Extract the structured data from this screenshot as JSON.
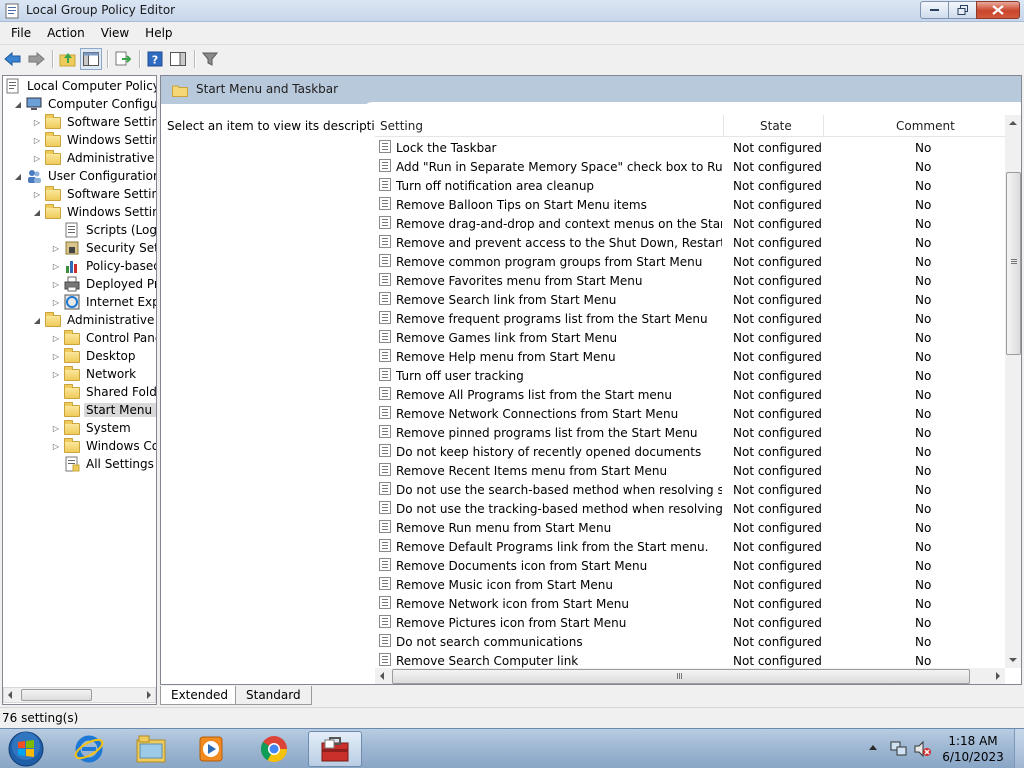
{
  "window": {
    "title": "Local Group Policy Editor",
    "controls": [
      "minimize-icon",
      "restore-icon",
      "close-icon"
    ]
  },
  "menu": [
    "File",
    "Action",
    "View",
    "Help"
  ],
  "toolbar": [
    "back-arrow-icon",
    "forward-arrow-icon",
    "up-folder-icon",
    "show-hide-tree-icon",
    "export-list-icon",
    "help-icon",
    "properties-pane-icon",
    "filter-icon"
  ],
  "tree": {
    "root": "Local Computer Policy",
    "items": [
      {
        "label": "Computer Configura",
        "level": 1,
        "expander": "expanded",
        "icon": "computer-icon"
      },
      {
        "label": "Software Settings",
        "level": 2,
        "expander": "collapsed",
        "icon": "folder-icon"
      },
      {
        "label": "Windows Setting",
        "level": 2,
        "expander": "collapsed",
        "icon": "folder-icon"
      },
      {
        "label": "Administrative Te",
        "level": 2,
        "expander": "collapsed",
        "icon": "folder-icon"
      },
      {
        "label": "User Configuration",
        "level": 1,
        "expander": "expanded",
        "icon": "users-icon"
      },
      {
        "label": "Software Settings",
        "level": 2,
        "expander": "collapsed",
        "icon": "folder-icon"
      },
      {
        "label": "Windows Setting",
        "level": 2,
        "expander": "expanded",
        "icon": "folder-icon"
      },
      {
        "label": "Scripts (Logon",
        "level": 3,
        "expander": "none",
        "icon": "script-icon"
      },
      {
        "label": "Security Settin",
        "level": 3,
        "expander": "collapsed",
        "icon": "security-icon"
      },
      {
        "label": "Policy-based",
        "level": 3,
        "expander": "collapsed",
        "icon": "chart-icon"
      },
      {
        "label": "Deployed Prin",
        "level": 3,
        "expander": "collapsed",
        "icon": "printer-icon"
      },
      {
        "label": "Internet Explo",
        "level": 3,
        "expander": "collapsed",
        "icon": "internet-icon"
      },
      {
        "label": "Administrative Te",
        "level": 2,
        "expander": "expanded",
        "icon": "folder-icon"
      },
      {
        "label": "Control Panel",
        "level": 3,
        "expander": "collapsed",
        "icon": "folder-icon"
      },
      {
        "label": "Desktop",
        "level": 3,
        "expander": "collapsed",
        "icon": "folder-icon"
      },
      {
        "label": "Network",
        "level": 3,
        "expander": "collapsed",
        "icon": "folder-icon"
      },
      {
        "label": "Shared Folder",
        "level": 3,
        "expander": "none",
        "icon": "folder-icon"
      },
      {
        "label": "Start Menu ar",
        "level": 3,
        "expander": "none",
        "icon": "folder-icon",
        "selected": true
      },
      {
        "label": "System",
        "level": 3,
        "expander": "collapsed",
        "icon": "folder-icon"
      },
      {
        "label": "Windows Cor",
        "level": 3,
        "expander": "collapsed",
        "icon": "folder-icon"
      },
      {
        "label": "All Settings",
        "level": 3,
        "expander": "none",
        "icon": "all-settings-icon"
      }
    ]
  },
  "main": {
    "header_title": "Start Menu and Taskbar",
    "description": "Select an item to view its description.",
    "columns": {
      "setting": "Setting",
      "state": "State",
      "comment": "Comment"
    },
    "rows": [
      {
        "setting": "Lock the Taskbar",
        "state": "Not configured",
        "comment": "No"
      },
      {
        "setting": "Add \"Run in Separate Memory Space\" check box to Run dial...",
        "state": "Not configured",
        "comment": "No"
      },
      {
        "setting": "Turn off notification area cleanup",
        "state": "Not configured",
        "comment": "No"
      },
      {
        "setting": "Remove Balloon Tips on Start Menu items",
        "state": "Not configured",
        "comment": "No"
      },
      {
        "setting": "Remove drag-and-drop and context menus on the Start Me...",
        "state": "Not configured",
        "comment": "No"
      },
      {
        "setting": "Remove and prevent access to the Shut Down, Restart, Sleep...",
        "state": "Not configured",
        "comment": "No"
      },
      {
        "setting": "Remove common program groups from Start Menu",
        "state": "Not configured",
        "comment": "No"
      },
      {
        "setting": "Remove Favorites menu from Start Menu",
        "state": "Not configured",
        "comment": "No"
      },
      {
        "setting": "Remove Search link from Start Menu",
        "state": "Not configured",
        "comment": "No"
      },
      {
        "setting": "Remove frequent programs list from the Start Menu",
        "state": "Not configured",
        "comment": "No"
      },
      {
        "setting": "Remove Games link from Start Menu",
        "state": "Not configured",
        "comment": "No"
      },
      {
        "setting": "Remove Help menu from Start Menu",
        "state": "Not configured",
        "comment": "No"
      },
      {
        "setting": "Turn off user tracking",
        "state": "Not configured",
        "comment": "No"
      },
      {
        "setting": "Remove All Programs list from the Start menu",
        "state": "Not configured",
        "comment": "No"
      },
      {
        "setting": "Remove Network Connections from Start Menu",
        "state": "Not configured",
        "comment": "No"
      },
      {
        "setting": "Remove pinned programs list from the Start Menu",
        "state": "Not configured",
        "comment": "No"
      },
      {
        "setting": "Do not keep history of recently opened documents",
        "state": "Not configured",
        "comment": "No"
      },
      {
        "setting": "Remove Recent Items menu from Start Menu",
        "state": "Not configured",
        "comment": "No"
      },
      {
        "setting": "Do not use the search-based method when resolving shell s...",
        "state": "Not configured",
        "comment": "No"
      },
      {
        "setting": "Do not use the tracking-based method when resolving shell ...",
        "state": "Not configured",
        "comment": "No"
      },
      {
        "setting": "Remove Run menu from Start Menu",
        "state": "Not configured",
        "comment": "No"
      },
      {
        "setting": "Remove Default Programs link from the Start menu.",
        "state": "Not configured",
        "comment": "No"
      },
      {
        "setting": "Remove Documents icon from Start Menu",
        "state": "Not configured",
        "comment": "No"
      },
      {
        "setting": "Remove Music icon from Start Menu",
        "state": "Not configured",
        "comment": "No"
      },
      {
        "setting": "Remove Network icon from Start Menu",
        "state": "Not configured",
        "comment": "No"
      },
      {
        "setting": "Remove Pictures icon from Start Menu",
        "state": "Not configured",
        "comment": "No"
      },
      {
        "setting": "Do not search communications",
        "state": "Not configured",
        "comment": "No"
      },
      {
        "setting": "Remove Search Computer link",
        "state": "Not configured",
        "comment": "No"
      }
    ]
  },
  "tabs": [
    {
      "label": "Extended",
      "active": true
    },
    {
      "label": "Standard",
      "active": false
    }
  ],
  "status": "76 setting(s)",
  "taskbar": {
    "apps": [
      "internet-explorer-icon",
      "windows-explorer-icon",
      "media-player-icon",
      "chrome-icon",
      "group-policy-editor-icon"
    ],
    "active_app": "group-policy-editor-icon",
    "tray_icons": [
      "show-hidden-icons-icon",
      "network-icon",
      "volume-muted-icon"
    ],
    "time": "1:18 AM",
    "date": "6/10/2023"
  },
  "colors": {
    "header_band": "#b9c9dc",
    "taskbar": "#9fb8d3",
    "close_button": "#c9462c"
  }
}
